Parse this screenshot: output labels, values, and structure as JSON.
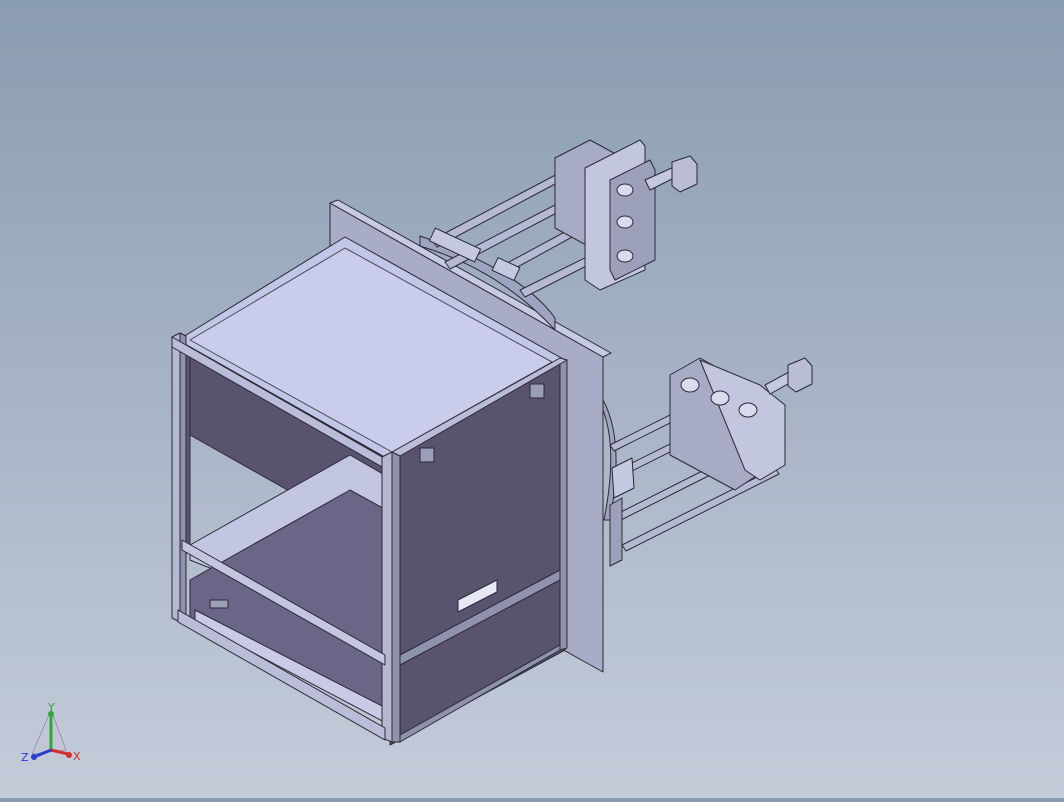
{
  "view": {
    "background_top": "#8a9cb2",
    "background_bottom": "#c5ccda",
    "model_face_light": "#c0c5e6",
    "model_face_mid": "#a7acc9",
    "model_face_dark": "#5a5370",
    "edge_color": "#2a2a35"
  },
  "triad": {
    "x_label": "X",
    "y_label": "Y",
    "z_label": "Z",
    "x_color": "#d0302a",
    "y_color": "#2ea83a",
    "z_color": "#2a3bd0"
  }
}
